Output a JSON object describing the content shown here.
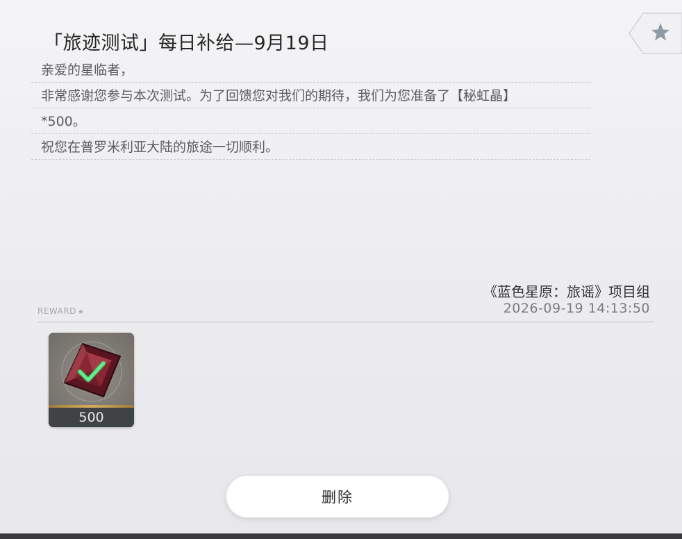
{
  "mail": {
    "title": "「旅迹测试」每日补给—9月19日",
    "body_lines": [
      "亲爱的星临者，",
      "非常感谢您参与本次测试。为了回馈您对我们的期待，我们为您准备了【秘虹晶】",
      "*500。",
      "祝您在普罗米利亚大陆的旅途一切顺利。"
    ],
    "sender": "《蓝色星原：旅谣》项目组",
    "date": "2026-09-19 14:13:50",
    "favorite_icon": "star-icon"
  },
  "reward": {
    "label": "REWARD",
    "label_icon": "star-icon",
    "items": [
      {
        "icon": "red-gem-icon",
        "claimed_icon": "check-icon",
        "count": "500",
        "claimed": true
      }
    ]
  },
  "actions": {
    "delete_label": "删除"
  },
  "colors": {
    "gem": "#7a1e2a",
    "check": "#4ee07a",
    "count_bar": "#3f4346",
    "rarity_strip": "#d6ae5e"
  }
}
